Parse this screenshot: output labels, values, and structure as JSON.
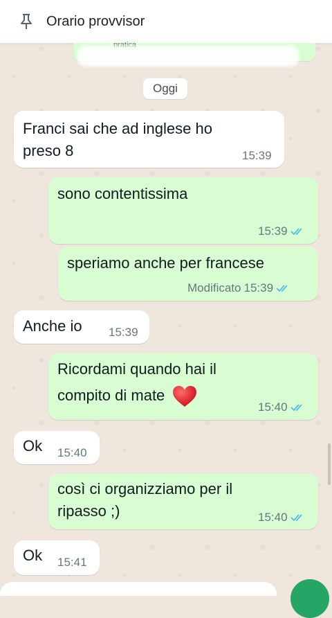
{
  "pinned": {
    "text": "Orario provvisor",
    "icon": "pin-icon"
  },
  "top_partial": {
    "text": "pratica",
    "icon": "check-icon"
  },
  "date_chip": "Oggi",
  "messages": [
    {
      "dir": "in",
      "lines": [
        "Franci sai che ad inglese ho",
        "preso 8"
      ],
      "time": "15:39"
    },
    {
      "dir": "out",
      "lines": [
        "sono contentissima"
      ],
      "time": "15:39",
      "ticks": "double-check-blue"
    },
    {
      "dir": "out",
      "lines": [
        "speriamo anche per francese"
      ],
      "edited": "Modificato",
      "time": "15:39",
      "ticks": "double-check-blue"
    },
    {
      "dir": "in",
      "lines": [
        "Anche io"
      ],
      "time": "15:39"
    },
    {
      "dir": "out",
      "lines": [
        "Ricordami quando hai il",
        "compito di mate"
      ],
      "emoji": "red-heart",
      "time": "15:40",
      "ticks": "double-check-blue"
    },
    {
      "dir": "in",
      "lines": [
        "Ok"
      ],
      "time": "15:40"
    },
    {
      "dir": "out",
      "lines": [
        "così ci organizziamo per il",
        "ripasso ;)"
      ],
      "time": "15:40",
      "ticks": "double-check-blue"
    },
    {
      "dir": "in",
      "lines": [
        "Ok"
      ],
      "time": "15:41"
    }
  ],
  "colors": {
    "incoming": "#ffffff",
    "outgoing": "#d9fdd3",
    "read_ticks": "#53bdeb",
    "wallpaper": "#efe7dd"
  }
}
